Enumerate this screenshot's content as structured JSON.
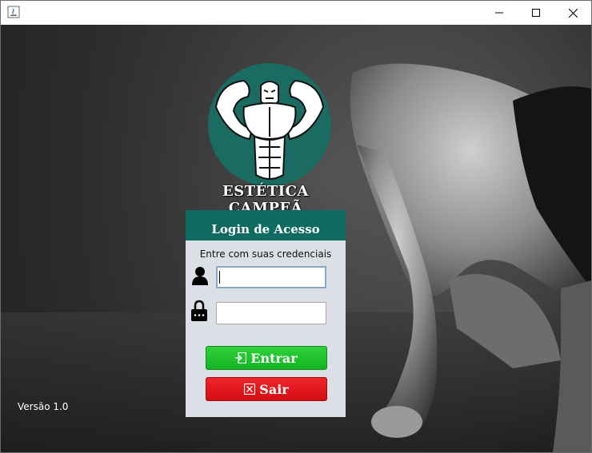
{
  "window": {
    "icons": {
      "app": "java-app-icon",
      "minimize": "minimize-icon",
      "maximize": "maximize-icon",
      "close": "close-icon"
    }
  },
  "brand": {
    "name": "ESTÉTICA CAMPEÃ",
    "logo_icon": "bodybuilder-logo-icon",
    "logo_color": "#1a6b62"
  },
  "login": {
    "title": "Login de Acesso",
    "subtitle": "Entre com suas credenciais",
    "username": {
      "value": "",
      "placeholder": "",
      "icon": "user-icon"
    },
    "password": {
      "value": "",
      "placeholder": "",
      "icon": "lock-icon"
    },
    "enter_label": "Entrar",
    "exit_label": "Sair",
    "enter_icon": "enter-icon",
    "exit_icon": "exit-icon"
  },
  "footer": {
    "version": "Versão 1.0"
  },
  "colors": {
    "header": "#0f6b62",
    "panel": "#dcdfe6",
    "enter": "#1ec42c",
    "exit": "#e3161b"
  }
}
